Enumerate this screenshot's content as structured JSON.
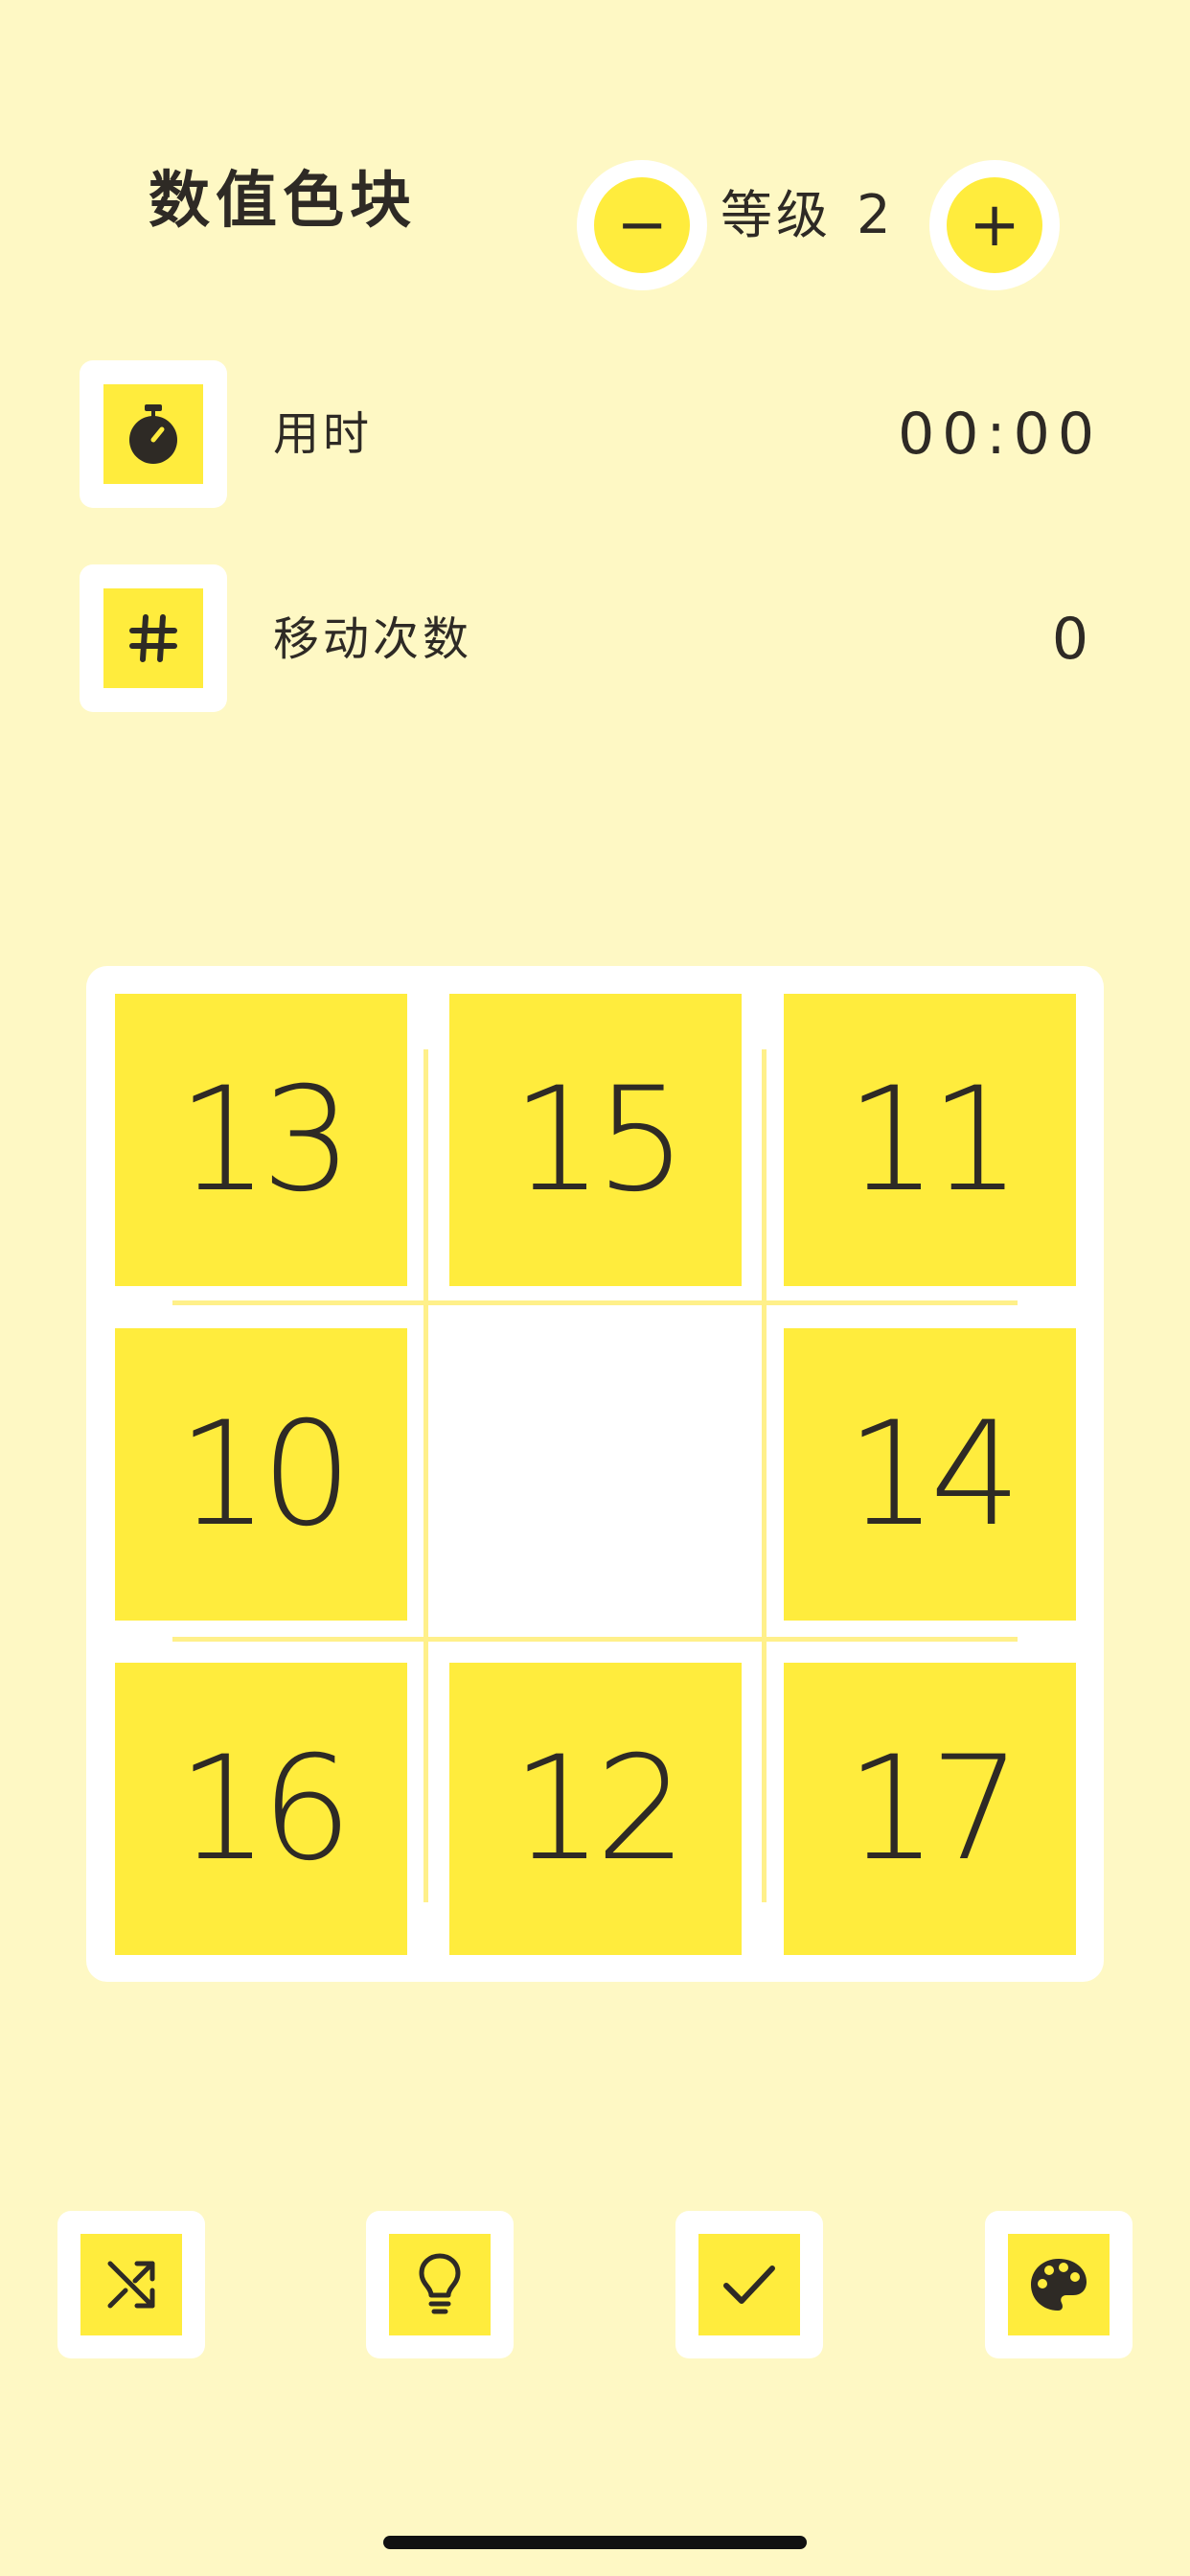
{
  "header": {
    "title": "数值色块",
    "level_label": "等级",
    "level_value": "2",
    "minus_label": "−",
    "plus_label": "+"
  },
  "stats": {
    "time_label": "用时",
    "time_value": "00:00",
    "moves_label": "移动次数",
    "moves_value": "0"
  },
  "board": {
    "size": 3,
    "tiles": [
      "13",
      "15",
      "11",
      "10",
      "",
      "14",
      "16",
      "12",
      "17"
    ]
  },
  "toolbar": {
    "icons": [
      "shuffle-icon",
      "lightbulb-icon",
      "check-icon",
      "palette-icon"
    ]
  },
  "colors": {
    "background": "#FEF8C4",
    "tile": "#FFEC3D",
    "frame": "#FFFFFF",
    "text": "#2E2A25"
  }
}
